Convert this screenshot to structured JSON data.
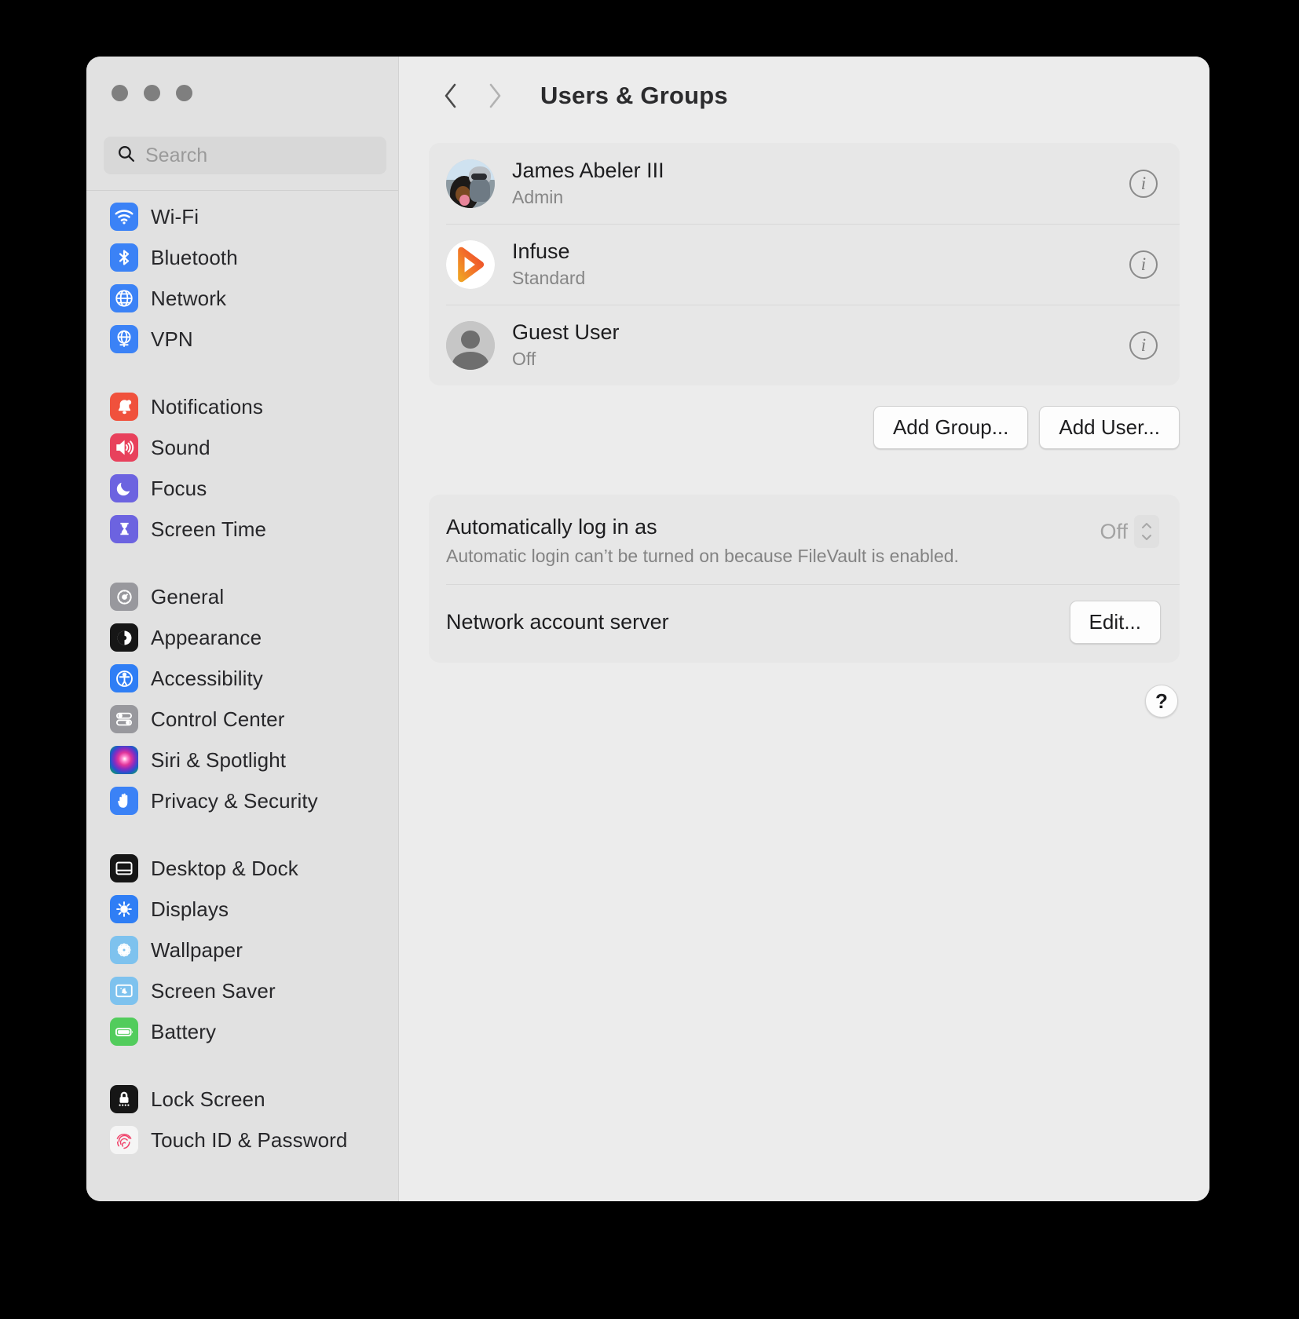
{
  "window": {
    "traffic_lights": [
      "close",
      "minimize",
      "maximize"
    ]
  },
  "search": {
    "placeholder": "Search",
    "value": "",
    "icon": "search-icon"
  },
  "sidebar": {
    "groups": [
      {
        "items": [
          {
            "label": "Wi-Fi",
            "icon": "wifi-icon",
            "color": "#3b82f6"
          },
          {
            "label": "Bluetooth",
            "icon": "bluetooth-icon",
            "color": "#3b82f6"
          },
          {
            "label": "Network",
            "icon": "globe-icon",
            "color": "#3b82f6"
          },
          {
            "label": "VPN",
            "icon": "vpn-globe-icon",
            "color": "#3b82f6"
          }
        ]
      },
      {
        "items": [
          {
            "label": "Notifications",
            "icon": "bell-icon",
            "color": "#f0513c"
          },
          {
            "label": "Sound",
            "icon": "speaker-icon",
            "color": "#e8415c"
          },
          {
            "label": "Focus",
            "icon": "moon-icon",
            "color": "#6c63e0"
          },
          {
            "label": "Screen Time",
            "icon": "hourglass-icon",
            "color": "#6c63e0"
          }
        ]
      },
      {
        "items": [
          {
            "label": "General",
            "icon": "gear-icon",
            "color": "#98989d"
          },
          {
            "label": "Appearance",
            "icon": "contrast-icon",
            "color": "#161616"
          },
          {
            "label": "Accessibility",
            "icon": "accessibility-icon",
            "color": "#2f7ef5"
          },
          {
            "label": "Control Center",
            "icon": "sliders-icon",
            "color": "#98989d"
          },
          {
            "label": "Siri & Spotlight",
            "icon": "siri-icon",
            "color": "#5a2a6e"
          },
          {
            "label": "Privacy & Security",
            "icon": "hand-icon",
            "color": "#3b82f6"
          }
        ]
      },
      {
        "items": [
          {
            "label": "Desktop & Dock",
            "icon": "desktop-dock-icon",
            "color": "#161616"
          },
          {
            "label": "Displays",
            "icon": "brightness-icon",
            "color": "#2f7ef5"
          },
          {
            "label": "Wallpaper",
            "icon": "flower-icon",
            "color": "#7ec2ee"
          },
          {
            "label": "Screen Saver",
            "icon": "screensaver-icon",
            "color": "#7ec2ee"
          },
          {
            "label": "Battery",
            "icon": "battery-icon",
            "color": "#52cc5c"
          }
        ]
      },
      {
        "items": [
          {
            "label": "Lock Screen",
            "icon": "lock-icon",
            "color": "#161616"
          },
          {
            "label": "Touch ID & Password",
            "icon": "fingerprint-icon",
            "color": "#f5f5f5"
          }
        ]
      }
    ]
  },
  "header": {
    "back_icon": "chevron-left-icon",
    "forward_icon": "chevron-right-icon",
    "title": "Users & Groups"
  },
  "users": [
    {
      "name": "James Abeler III",
      "role": "Admin",
      "avatar": "photo-avatar",
      "info_icon": "info-icon"
    },
    {
      "name": "Infuse",
      "role": "Standard",
      "avatar": "infuse-avatar",
      "info_icon": "info-icon"
    },
    {
      "name": "Guest User",
      "role": "Off",
      "avatar": "person-avatar",
      "info_icon": "info-icon"
    }
  ],
  "actions": {
    "add_group": "Add Group...",
    "add_user": "Add User..."
  },
  "login": {
    "title": "Automatically log in as",
    "subtitle": "Automatic login can’t be turned on because FileVault is enabled.",
    "value": "Off",
    "stepper_icon": "stepper-chevrons-icon",
    "network_label": "Network account server",
    "edit_button": "Edit..."
  },
  "help": {
    "label": "?",
    "icon": "help-icon"
  },
  "colors": {
    "window_bg": "#ececec",
    "sidebar_bg": "#e1e1e1",
    "card_bg": "#e7e7e7",
    "accent_blue": "#3b82f6",
    "text_primary": "#1d1d1f",
    "text_secondary": "#868686"
  }
}
